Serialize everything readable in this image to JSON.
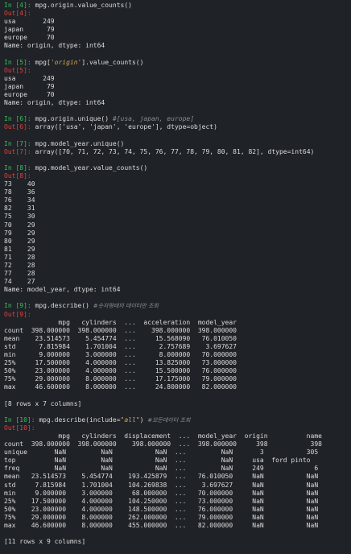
{
  "cells": [
    {
      "in": "In [4]:",
      "out": "Out[4]:",
      "code": [
        {
          "t": "mpg.origin.value_counts()"
        }
      ],
      "output": [
        "usa       249",
        "japan      79",
        "europe     70",
        "Name: origin, dtype: int64"
      ]
    },
    {
      "in": "In [5]:",
      "out": "Out[5]:",
      "code": [
        {
          "t": "mpg["
        },
        {
          "t": "'origin'",
          "c": "str"
        },
        {
          "t": "].value_counts()"
        }
      ],
      "output": [
        "usa       249",
        "japan      79",
        "europe     70",
        "Name: origin, dtype: int64"
      ]
    },
    {
      "in": "In [6]:",
      "out": "Out[6]:",
      "code": [
        {
          "t": "mpg.origin.unique() "
        },
        {
          "t": "#[usa, japan, europe]",
          "c": "cmt"
        }
      ],
      "output": [
        "array(['usa', 'japan', 'europe'], dtype=object)"
      ],
      "inline": true
    },
    {
      "in": "In [7]:",
      "out": "Out[7]:",
      "code": [
        {
          "t": "mpg.model_year.unique()"
        }
      ],
      "output": [
        "array([70, 71, 72, 73, 74, 75, 76, 77, 78, 79, 80, 81, 82], dtype=int64)"
      ],
      "inline": true
    },
    {
      "in": "In [8]:",
      "out": "Out[8]:",
      "code": [
        {
          "t": "mpg.model_year.value_counts()"
        }
      ],
      "output": [
        "73    40",
        "78    36",
        "76    34",
        "82    31",
        "75    30",
        "70    29",
        "79    29",
        "80    29",
        "81    29",
        "71    28",
        "72    28",
        "77    28",
        "74    27",
        "Name: model_year, dtype: int64"
      ]
    },
    {
      "in": "In [9]:",
      "out": "Out[9]:",
      "code": [
        {
          "t": "mpg.describe() "
        },
        {
          "t": "#숫자형태의 데이터만 조회",
          "c": "cmt hangul"
        }
      ],
      "output": [
        "              mpg   cylinders  ...  acceleration  model_year",
        "count  398.000000  398.000000  ...    398.000000  398.000000",
        "mean    23.514573    5.454774  ...     15.568090   76.010050",
        "std      7.815984    1.701004  ...      2.757689    3.697627",
        "min      9.000000    3.000000  ...      8.000000   70.000000",
        "25%     17.500000    4.000000  ...     13.825000   73.000000",
        "50%     23.000000    4.000000  ...     15.500000   76.000000",
        "75%     29.000000    8.000000  ...     17.175000   79.000000",
        "max     46.600000    8.000000  ...     24.800000   82.000000",
        "",
        "[8 rows x 7 columns]"
      ]
    },
    {
      "in": "In [10]:",
      "out": "Out[10]:",
      "code": [
        {
          "t": "mpg.describe(include="
        },
        {
          "t": "\"all\"",
          "c": "str"
        },
        {
          "t": ") "
        },
        {
          "t": "#모든데이터 조회",
          "c": "cmt hangul"
        }
      ],
      "output": [
        "              mpg   cylinders  displacement  ...  model_year  origin          name",
        "count  398.000000  398.000000    398.000000  ...  398.000000     398           398",
        "unique       NaN         NaN           NaN  ...         NaN       3           305",
        "top          NaN         NaN           NaN  ...         NaN     usa  ford pinto",
        "freq         NaN         NaN           NaN  ...         NaN     249             6",
        "mean   23.514573    5.454774    193.425879  ...   76.010050     NaN           NaN",
        "std     7.815984    1.701004    104.269838  ...    3.697627     NaN           NaN",
        "min     9.000000    3.000000     68.000000  ...   70.000000     NaN           NaN",
        "25%    17.500000    4.000000    104.250000  ...   73.000000     NaN           NaN",
        "50%    23.000000    4.000000    148.500000  ...   76.000000     NaN           NaN",
        "75%    29.000000    8.000000    262.000000  ...   79.000000     NaN           NaN",
        "max    46.600000    8.000000    455.000000  ...   82.000000     NaN           NaN",
        "",
        "[11 rows x 9 columns]"
      ]
    }
  ]
}
